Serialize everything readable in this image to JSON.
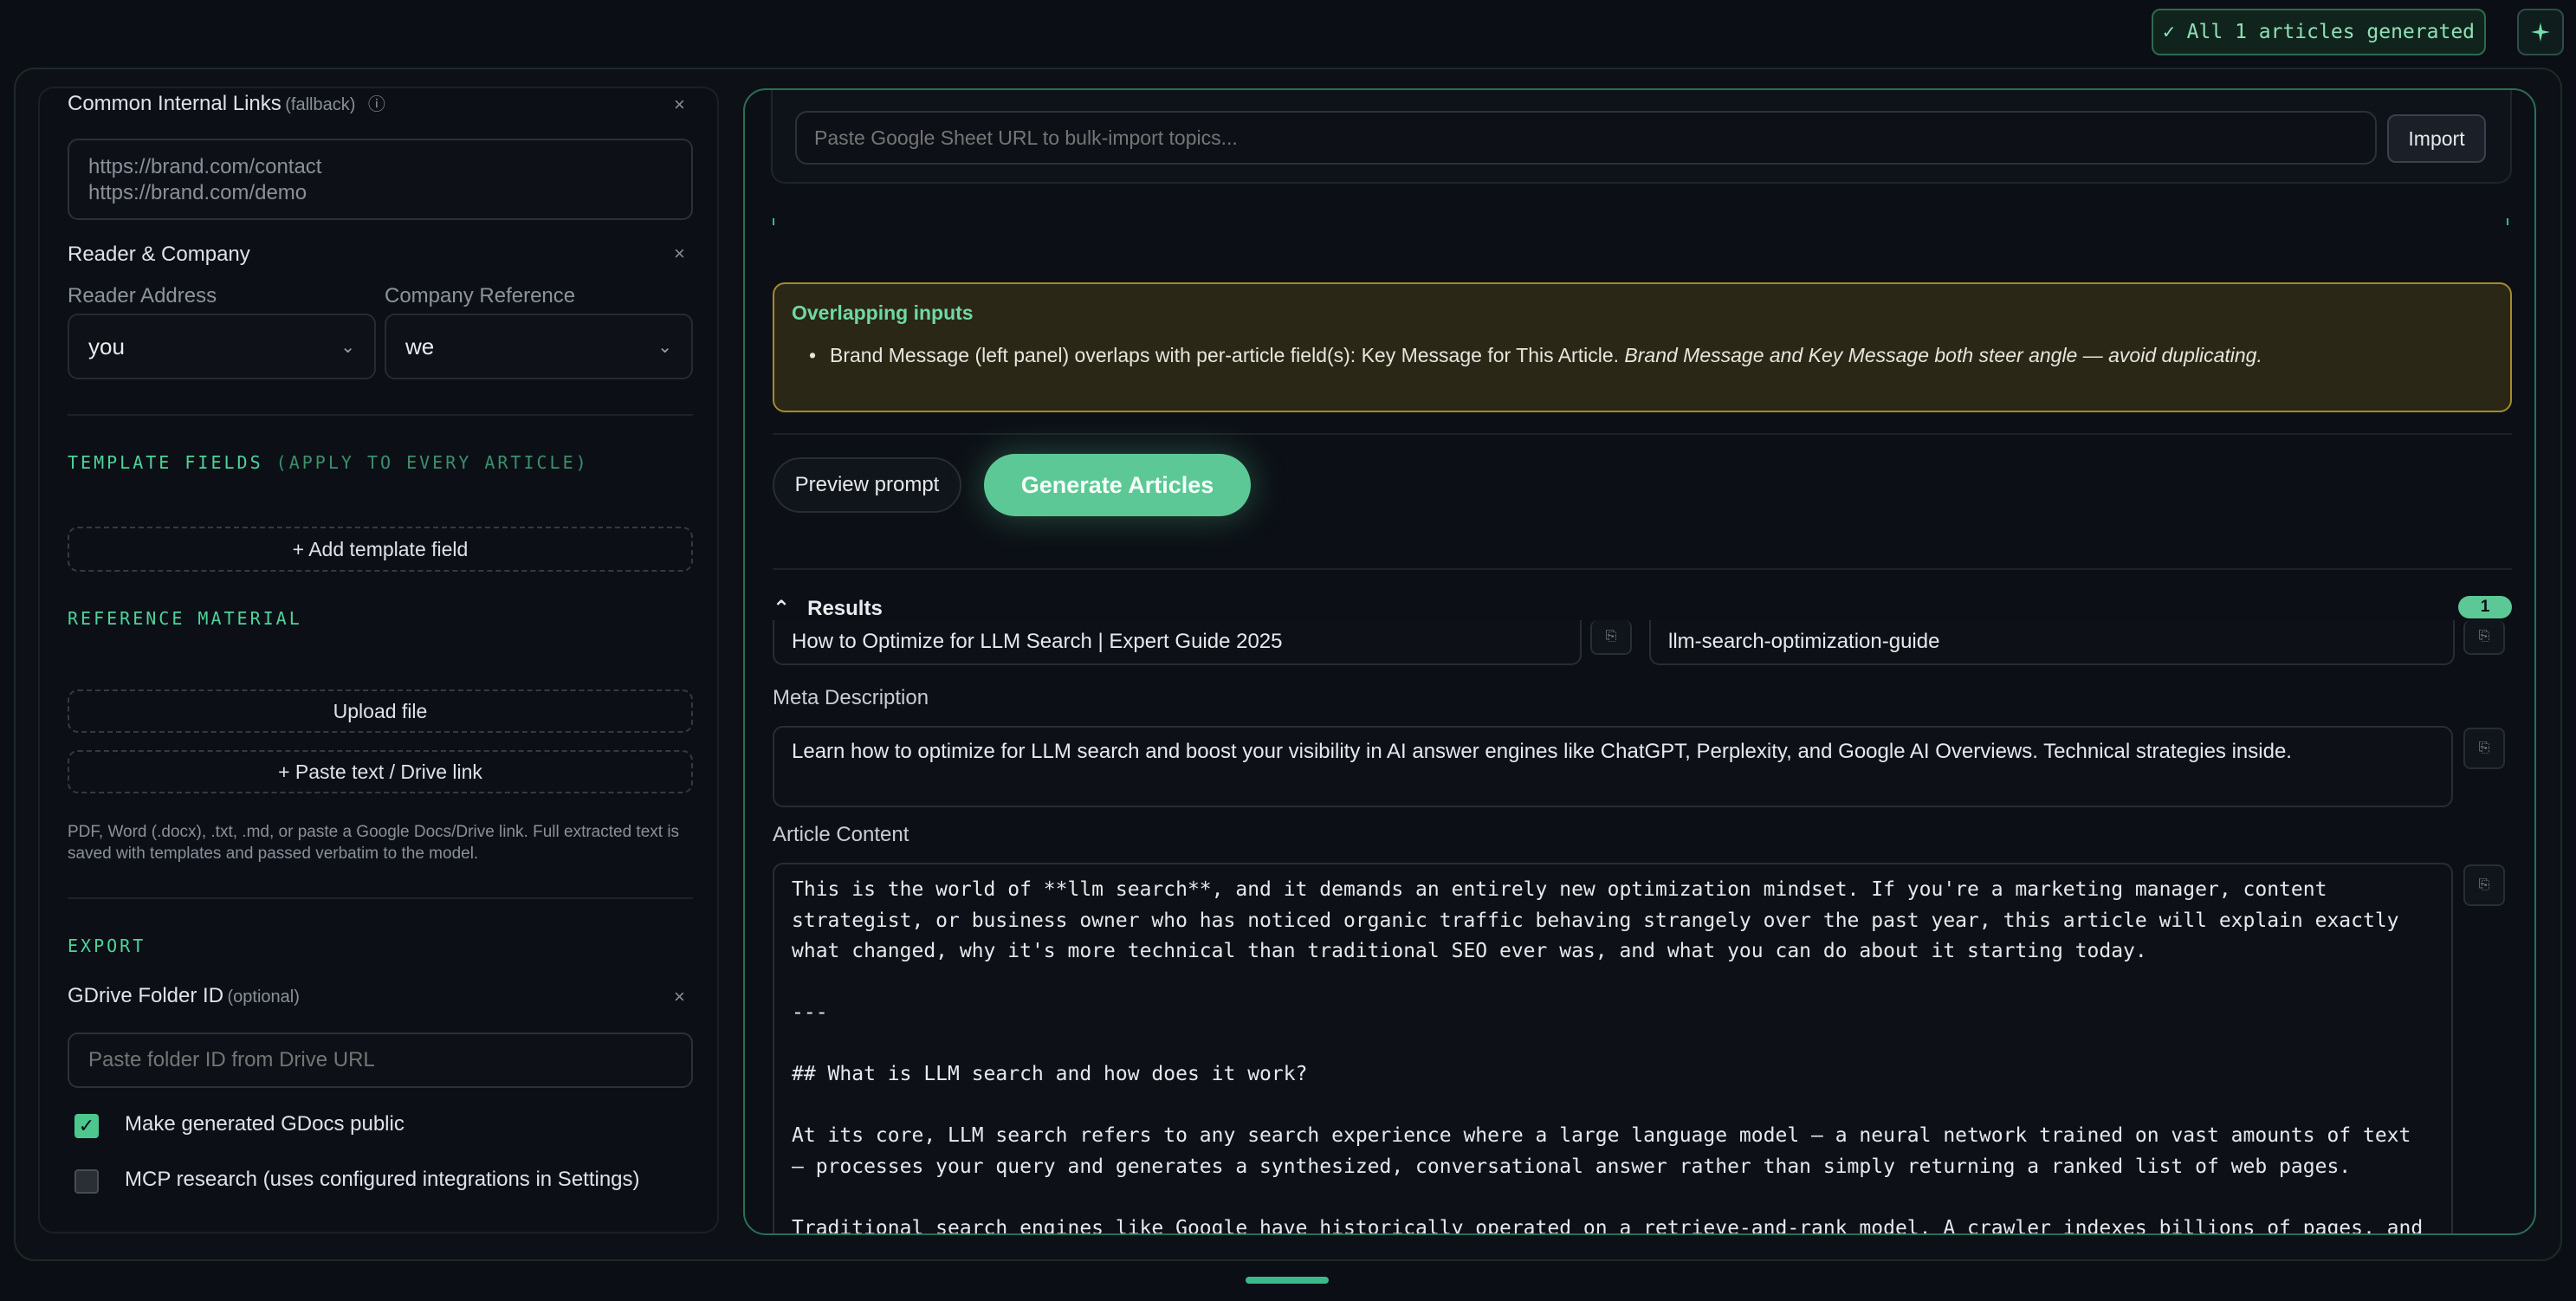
{
  "status": {
    "text": "✓ All 1 articles generated",
    "sparkle_icon": "sparkle-icon"
  },
  "left": {
    "internal_links": {
      "label": "Common Internal Links",
      "sub": "(fallback)",
      "info_glyph": "ⓘ",
      "close_glyph": "×",
      "placeholder_line1": "https://brand.com/contact",
      "placeholder_line2": "https://brand.com/demo"
    },
    "reader_company": {
      "label": "Reader & Company",
      "close_glyph": "×",
      "reader_label": "Reader Address",
      "reader_value": "you",
      "company_label": "Company Reference",
      "company_value": "we"
    },
    "template": {
      "title": "TEMPLATE FIELDS",
      "title_dim": "(APPLY TO EVERY ARTICLE)",
      "add_label": "+ Add template field"
    },
    "reference": {
      "title": "REFERENCE MATERIAL",
      "upload_label": "Upload file",
      "paste_label": "+ Paste text / Drive link",
      "help": "PDF, Word (.docx), .txt, .md, or paste a Google Docs/Drive link. Full extracted text is saved with templates and passed verbatim to the model."
    },
    "export": {
      "title": "EXPORT",
      "folder_label": "GDrive Folder ID",
      "folder_sub": "(optional)",
      "close_glyph": "×",
      "folder_placeholder": "Paste folder ID from Drive URL",
      "public_label": "Make generated GDocs public",
      "public_checked": true,
      "mcp_label": "MCP research (uses configured integrations in Settings)",
      "mcp_checked": false
    }
  },
  "right": {
    "sheet_placeholder": "Paste Google Sheet URL to bulk-import topics...",
    "import_label": "Import",
    "warning": {
      "title": "Overlapping inputs",
      "item_text": "Brand Message (left panel) overlaps with per-article field(s): Key Message for This Article.",
      "item_em": "Brand Message and Key Message both steer angle — avoid duplicating."
    },
    "preview_label": "Preview prompt",
    "generate_label": "Generate Articles",
    "results": {
      "label": "Results",
      "chevron_glyph": "⌃",
      "count": "1",
      "title_value": "How to Optimize for LLM Search | Expert Guide 2025",
      "slug_value": "llm-search-optimization-guide",
      "meta_label": "Meta Description",
      "meta_value": "Learn how to optimize for LLM search and boost your visibility in AI answer engines like ChatGPT, Perplexity, and Google AI Overviews. Technical strategies inside.",
      "content_label": "Article Content",
      "content_value": "This is the world of **llm search**, and it demands an entirely new optimization mindset. If you're a marketing manager, content strategist, or business owner who has noticed organic traffic behaving strangely over the past year, this article will explain exactly what changed, why it's more technical than traditional SEO ever was, and what you can do about it starting today.\n\n---\n\n## What is LLM search and how does it work?\n\nAt its core, LLM search refers to any search experience where a large language model — a neural network trained on vast amounts of text — processes your query and generates a synthesized, conversational answer rather than simply returning a ranked list of web pages.\n\nTraditional search engines like Google have historically operated on a retrieve-and-rank model. A crawler indexes billions of pages, and",
      "copy_glyph": "⎘"
    }
  }
}
